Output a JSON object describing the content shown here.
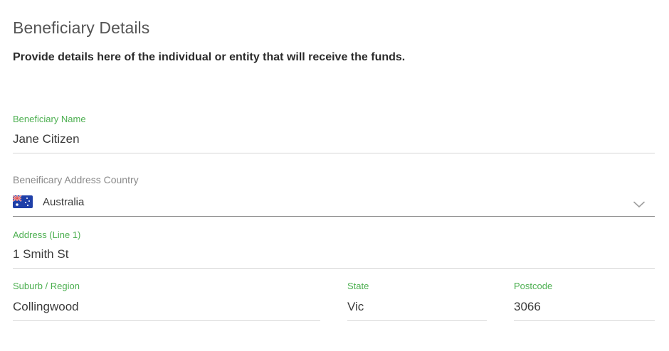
{
  "section": {
    "title": "Beneficiary Details",
    "description": "Provide details here of the individual or entity that will receive the funds."
  },
  "fields": {
    "beneficiary_name": {
      "label": "Beneficiary Name",
      "value": "Jane Citizen"
    },
    "address_country": {
      "label": "Beneificary Address Country",
      "value": "Australia",
      "flag_icon": "australia-flag-icon",
      "dropdown_icon": "chevron-down-icon"
    },
    "address_line1": {
      "label": "Address (Line 1)",
      "value": "1 Smith St"
    },
    "suburb": {
      "label": "Suburb / Region",
      "value": "Collingwood"
    },
    "state": {
      "label": "State",
      "value": "Vic"
    },
    "postcode": {
      "label": "Postcode",
      "value": "3066"
    }
  },
  "colors": {
    "label_accent": "#4caf50",
    "label_muted": "#8a8a8a",
    "underline": "#d6d6d6",
    "underline_select": "#8c8c8c"
  }
}
